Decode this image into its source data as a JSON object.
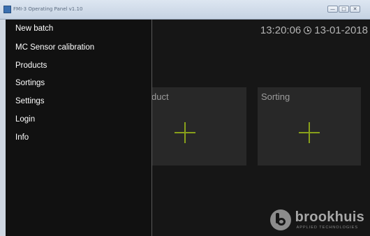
{
  "window": {
    "title": "FMI-3 Operating Panel v1.10",
    "controls": [
      "minimize",
      "maximize",
      "close"
    ]
  },
  "header": {
    "time": "13:20:06",
    "clock_icon": "clock-icon",
    "date": "13-01-2018"
  },
  "cards": {
    "product": {
      "title": "duct",
      "icon": "plus-icon"
    },
    "sorting": {
      "title": "Sorting",
      "icon": "plus-icon"
    }
  },
  "brand": {
    "logo_icon": "brookhuis-logo-icon",
    "name": "brookhuis",
    "tagline": "APPLIED TECHNOLOGIES"
  },
  "menu": {
    "items": [
      {
        "label": "New batch"
      },
      {
        "label": "MC Sensor calibration"
      },
      {
        "label": "Products"
      },
      {
        "label": "Sortings"
      },
      {
        "label": "Settings"
      },
      {
        "label": "Login"
      },
      {
        "label": "Info"
      }
    ]
  },
  "colors": {
    "background": "#161616",
    "card": "#282828",
    "accent": "#88a01a",
    "menu": "#111111",
    "text": "#ffffff"
  }
}
